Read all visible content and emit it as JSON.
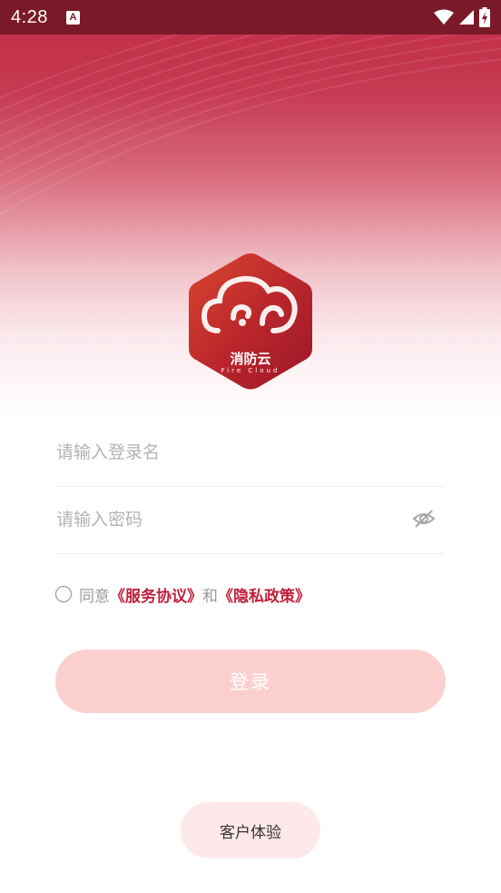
{
  "status_bar": {
    "time": "4:28",
    "notification_icon": "a-letter-icon",
    "icons": [
      "wifi-icon",
      "signal-icon",
      "battery-charging-icon"
    ]
  },
  "logo": {
    "cn_text": "消防云",
    "en_text": "Fire Cloud"
  },
  "form": {
    "username_placeholder": "请输入登录名",
    "password_placeholder": "请输入密码"
  },
  "agreement": {
    "prefix": "同意",
    "service_link": "《服务协议》",
    "and": "和",
    "privacy_link": "《隐私政策》"
  },
  "buttons": {
    "login": "登录",
    "guest": "客户体验"
  },
  "colors": {
    "brand": "#c0203c",
    "status_bar": "#7a1a28",
    "login_button": "#fdd0d0",
    "guest_button": "#fde8ea"
  }
}
